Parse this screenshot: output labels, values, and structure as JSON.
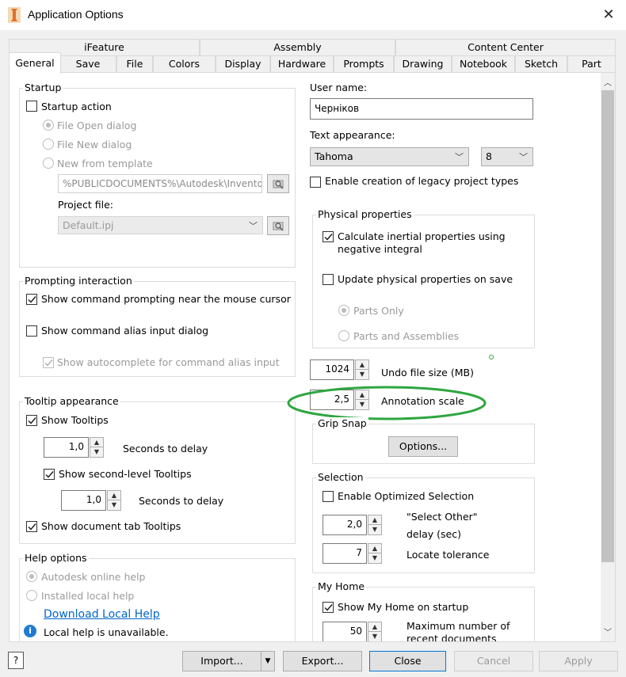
{
  "window": {
    "title": "Application Options"
  },
  "tabs_row1": [
    "iFeature",
    "Assembly",
    "Content Center"
  ],
  "tabs_row2": [
    "General",
    "Save",
    "File",
    "Colors",
    "Display",
    "Hardware",
    "Prompts",
    "Drawing",
    "Notebook",
    "Sketch",
    "Part"
  ],
  "startup": {
    "title": "Startup",
    "startup_action": "Startup action",
    "file_open": "File Open dialog",
    "file_new": "File New dialog",
    "new_from_template": "New from template",
    "template_path": "%PUBLICDOCUMENTS%\\Autodesk\\Inventor",
    "project_file_label": "Project file:",
    "project_file_value": "Default.ipj"
  },
  "prompting": {
    "title": "Prompting interaction",
    "show_prompting": "Show command prompting near the mouse cursor",
    "show_alias": "Show command alias input dialog",
    "show_autocomplete": "Show autocomplete for command alias input"
  },
  "tooltip": {
    "title": "Tooltip appearance",
    "show_tooltips": "Show Tooltips",
    "delay1_value": "1,0",
    "delay1_label": "Seconds to delay",
    "show_second": "Show second-level Tooltips",
    "delay2_value": "1,0",
    "delay2_label": "Seconds to delay",
    "show_doc_tab": "Show document tab Tooltips"
  },
  "help": {
    "title": "Help options",
    "online": "Autodesk online help",
    "local": "Installed local help",
    "download_link": "Download Local Help",
    "unavailable": "Local help is unavailable."
  },
  "right": {
    "user_name_label": "User name:",
    "user_name_value": "Черніков",
    "text_appearance_label": "Text appearance:",
    "font_value": "Tahoma",
    "size_value": "8",
    "legacy": "Enable creation of legacy project types"
  },
  "physical": {
    "title": "Physical properties",
    "calc_inertial": "Calculate inertial properties using negative integral",
    "update_on_save": "Update physical properties on save",
    "parts_only": "Parts Only",
    "parts_assemblies": "Parts and Assemblies"
  },
  "undo": {
    "value": "1024",
    "label": "Undo file size (MB)"
  },
  "annotation": {
    "value": "2,5",
    "label": "Annotation scale"
  },
  "grip_snap": {
    "title": "Grip Snap",
    "options_btn": "Options..."
  },
  "selection": {
    "title": "Selection",
    "enable_optimized": "Enable Optimized Selection",
    "select_other_value": "2,0",
    "select_other_label1": "\"Select Other\"",
    "select_other_label2": "delay (sec)",
    "locate_value": "7",
    "locate_label": "Locate tolerance"
  },
  "my_home": {
    "title": "My Home",
    "show_on_startup": "Show My Home on startup",
    "max_recent_value": "50",
    "max_recent_label1": "Maximum number of",
    "max_recent_label2": "recent documents"
  },
  "footer": {
    "help_icon": "?",
    "import": "Import...",
    "export": "Export...",
    "close": "Close",
    "cancel": "Cancel",
    "apply": "Apply"
  },
  "colors": {
    "annotation_highlight": "#2ea640",
    "link": "#0066cc",
    "primary_border": "#0078d7"
  }
}
